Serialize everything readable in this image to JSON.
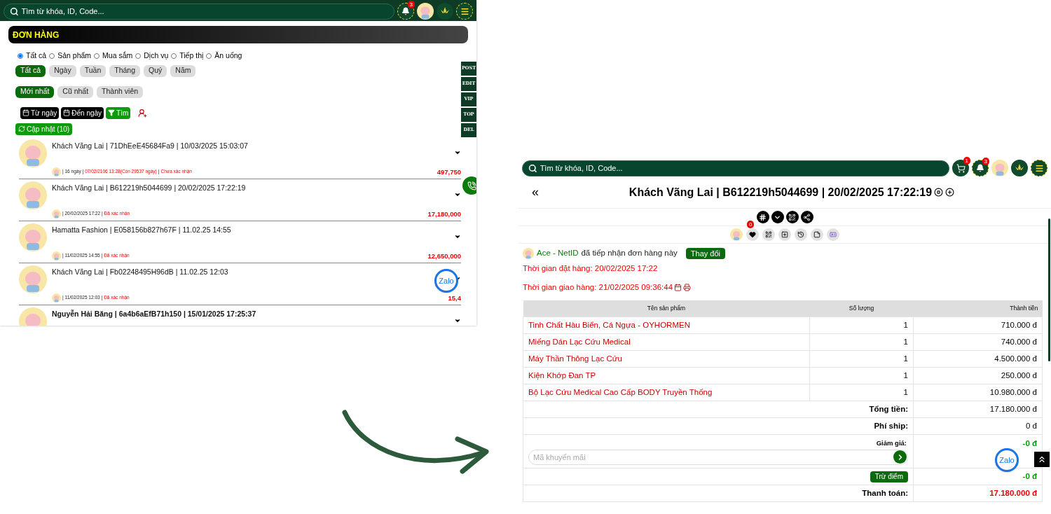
{
  "left": {
    "search": {
      "placeholder": "Tìm từ khóa, ID, Code..."
    },
    "notifications": "3",
    "title": "ĐƠN HÀNG",
    "categories": [
      {
        "label": "Tất cả",
        "selected": true
      },
      {
        "label": "Sản phẩm",
        "selected": false
      },
      {
        "label": "Mua sắm",
        "selected": false
      },
      {
        "label": "Dịch vụ",
        "selected": false
      },
      {
        "label": "Tiếp thị",
        "selected": false
      },
      {
        "label": "Ăn uống",
        "selected": false
      }
    ],
    "periods": [
      {
        "label": "Tất cả",
        "selected": true
      },
      {
        "label": "Ngày",
        "selected": false
      },
      {
        "label": "Tuần",
        "selected": false
      },
      {
        "label": "Tháng",
        "selected": false
      },
      {
        "label": "Quý",
        "selected": false
      },
      {
        "label": "Năm",
        "selected": false
      }
    ],
    "sorts": [
      {
        "label": "Mới nhất",
        "selected": true
      },
      {
        "label": "Cũ nhất",
        "selected": false
      },
      {
        "label": "Thành viên",
        "selected": false
      }
    ],
    "filters": [
      {
        "label": "Từ ngày",
        "kind": "date"
      },
      {
        "label": "Đến ngày",
        "kind": "date"
      },
      {
        "label": "Tìm",
        "kind": "search"
      }
    ],
    "refresh": "Cập nhật (10)",
    "side_tabs": [
      "POST",
      "EDIT",
      "VIP",
      "TOP",
      "DEL"
    ],
    "orders": [
      {
        "title": "Khách Vãng Lai | 71DhEeE45684Fa9 | 10/03/2025 15:03:07",
        "bold": false,
        "meta": [
          {
            "text": "| 16 ngày |",
            "kind": "info"
          },
          {
            "text": "07/02/2106 13:28(Còn 29537 ngày)",
            "kind": "alert"
          },
          {
            "text": "|",
            "kind": "info"
          },
          {
            "text": "Chưa xác nhận",
            "kind": "alert"
          }
        ],
        "amount": "497,750"
      },
      {
        "title": "Khách Vãng Lai | B612219h5044699 | 20/02/2025 17:22:19",
        "bold": false,
        "meta": [
          {
            "text": "| 20/02/2025 17:22 |",
            "kind": "info"
          },
          {
            "text": "Đã xác nhận",
            "kind": "alert"
          }
        ],
        "amount": "17,180,000"
      },
      {
        "title": "Hamatta Fashion | E058156b827h67F | 11.02.25 14:55",
        "bold": false,
        "meta": [
          {
            "text": "| 11/02/2025 14:55 |",
            "kind": "info"
          },
          {
            "text": "Đã xác nhận",
            "kind": "alert"
          }
        ],
        "amount": "12,650,000"
      },
      {
        "title": "Khách Vãng Lai | Fb02248495H96dB | 11.02.25 12:03",
        "bold": false,
        "meta": [
          {
            "text": "| 11/02/2025 12:03 |",
            "kind": "info"
          },
          {
            "text": "Đã xác nhận",
            "kind": "alert"
          }
        ],
        "amount": "15,4"
      },
      {
        "title": "Nguyễn Hải Băng | 6a4b6aEfB71h150 | 15/01/2025 17:25:37",
        "bold": true
      }
    ],
    "zalo": "Zalo"
  },
  "right": {
    "search": {
      "placeholder": "Tìm từ khóa, ID, Code..."
    },
    "cart": "1",
    "notifications": "3",
    "back": "«",
    "title": "Khách Vãng Lai | B612219h5044699 | 20/02/2025 17:22:19",
    "likes": "0",
    "receiver": {
      "name": "Ace - NetID",
      "text": "đã tiếp nhận đơn hàng này",
      "button": "Thay đổi"
    },
    "order_time": "Thời gian đặt hàng: 20/02/2025 17:22",
    "delivery_time": "Thời gian giao hàng: 21/02/2025 09:36:44",
    "table": {
      "columns": [
        "Tên sản phẩm",
        "Số lượng",
        "Thành tiền"
      ],
      "rows": [
        [
          "Tinh Chất Hàu Biển, Cá Ngựa - OYHORMEN",
          "1",
          "710.000 đ"
        ],
        [
          "Miếng Dán Lạc Cứu Medical",
          "1",
          "740.000 đ"
        ],
        [
          "Máy Thần Thông Lạc Cứu",
          "1",
          "4.500.000 đ"
        ],
        [
          "Kiện Khớp Đan TP",
          "1",
          "250.000 đ"
        ],
        [
          "Bộ Lạc Cứu Medical Cao Cấp BODY Truyền Thống",
          "1",
          "10.980.000 đ"
        ]
      ],
      "totals": [
        {
          "label": "Tổng tiền:",
          "value": "17.180.000 đ"
        },
        {
          "label": "Phí ship:",
          "value": "0 đ"
        }
      ],
      "discount": {
        "label": "Giảm giá:",
        "value": "-0 đ",
        "placeholder": "Mã khuyến mãi"
      },
      "points": {
        "button": "Trừ điểm",
        "value": "-0 đ"
      },
      "payment": {
        "label": "Thanh toán:",
        "value": "17.180.000 đ"
      }
    },
    "zalo": "Zalo"
  }
}
